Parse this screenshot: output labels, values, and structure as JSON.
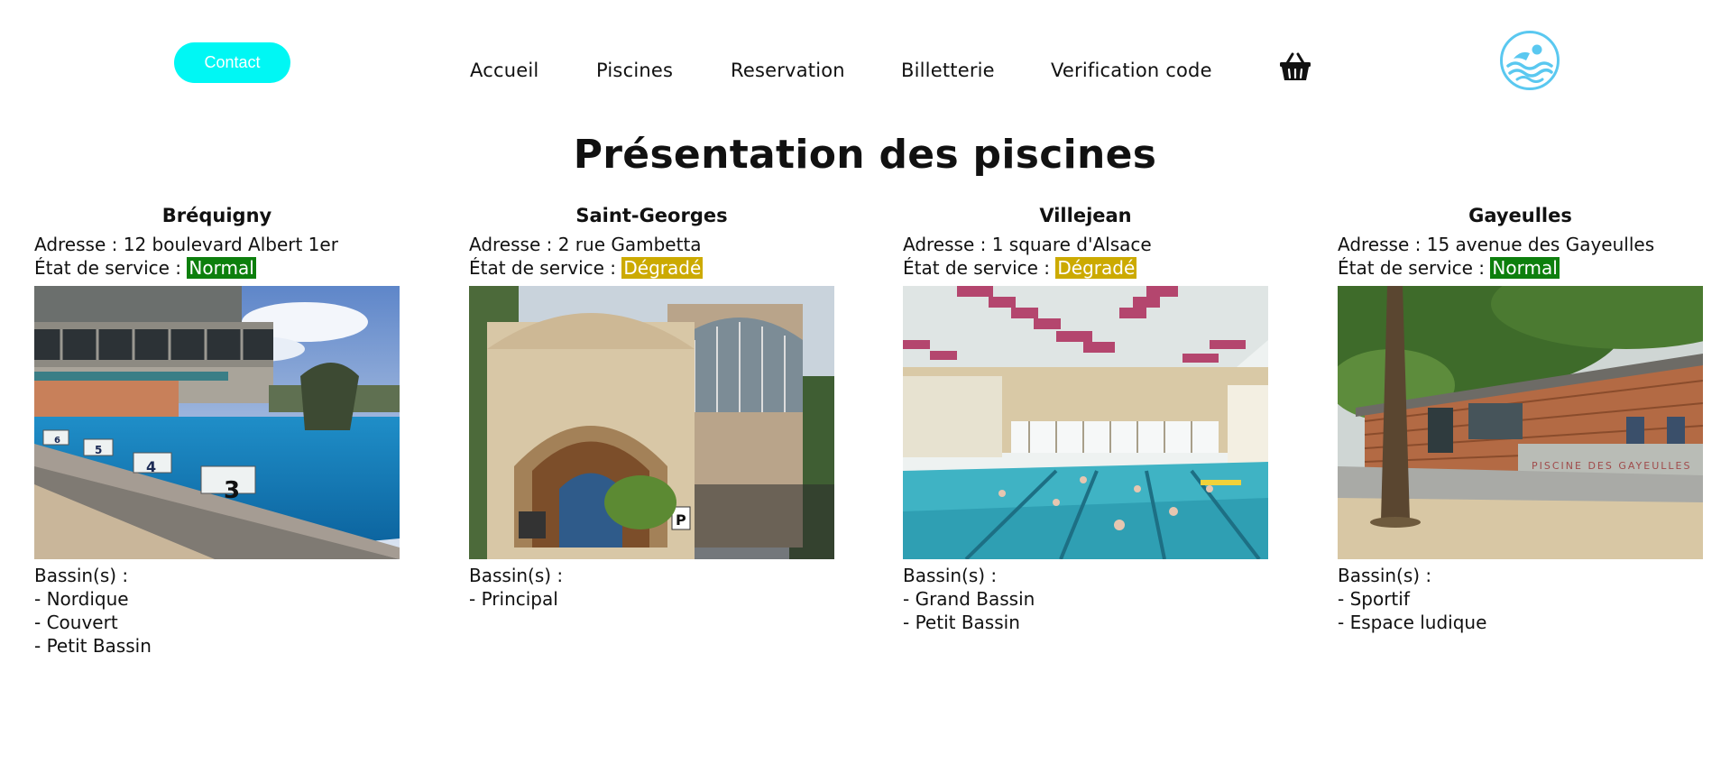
{
  "header": {
    "contact_label": "Contact",
    "nav": [
      {
        "label": "Accueil"
      },
      {
        "label": "Piscines"
      },
      {
        "label": "Reservation"
      },
      {
        "label": "Billetterie"
      },
      {
        "label": "Verification code"
      }
    ],
    "cart_icon": "basket-icon",
    "logo_icon": "swimmer-wave-logo"
  },
  "colors": {
    "contact_button": "#00f7f4",
    "status_normal": "#0d7f0d",
    "status_degraded": "#ccaa00",
    "logo": "#5ac8f0"
  },
  "page_title": "Présentation des piscines",
  "labels": {
    "address_prefix": "Adresse : ",
    "status_prefix": "État de service : ",
    "pools_heading": "Bassin(s) :"
  },
  "pools": [
    {
      "name": "Bréquigny",
      "address": "12 boulevard Albert 1er",
      "status": "Normal",
      "status_kind": "normal",
      "photo": "outdoor swimming pool with starting blocks",
      "basins": [
        "- Nordique",
        "- Couvert",
        "- Petit Bassin"
      ]
    },
    {
      "name": "Saint-Georges",
      "address": "2 rue Gambetta",
      "status": "Dégradé",
      "status_kind": "degrade",
      "photo": "historic ornate facade building",
      "basins": [
        "- Principal"
      ]
    },
    {
      "name": "Villejean",
      "address": "1 square d'Alsace",
      "status": "Dégradé",
      "status_kind": "degrade",
      "photo": "indoor swimming pool with swimmers",
      "basins": [
        "- Grand Bassin",
        "- Petit Bassin"
      ]
    },
    {
      "name": "Gayeulles",
      "address": "15 avenue des Gayeulles",
      "status": "Normal",
      "status_kind": "normal",
      "photo": "wooden building behind a large tree",
      "basins": [
        "- Sportif",
        "- Espace ludique"
      ]
    }
  ]
}
